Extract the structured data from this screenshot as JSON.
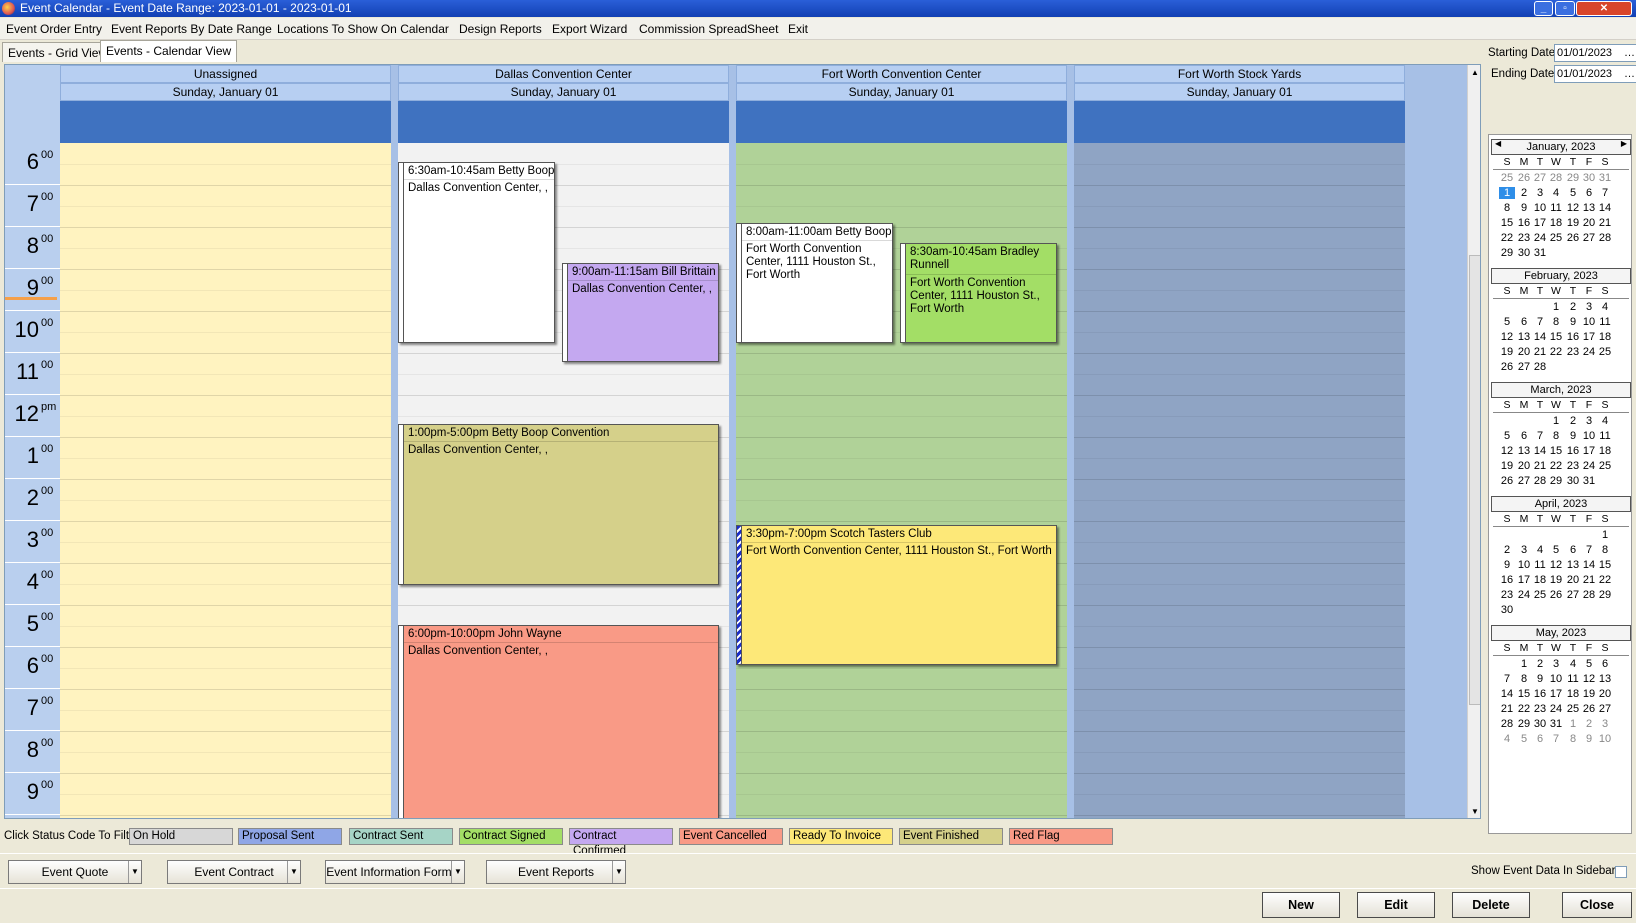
{
  "window": {
    "title": "Event Calendar - Event Date Range: 2023-01-01 - 2023-01-01"
  },
  "menu": [
    "Event Order Entry",
    "Event Reports By Date Range",
    "Locations To Show On Calendar",
    "Design Reports",
    "Export Wizard",
    "Commission SpreadSheet",
    "Exit"
  ],
  "tabs": [
    "Events - Grid View",
    "Events - Calendar View"
  ],
  "hours": [
    {
      "h": "6",
      "m": "00"
    },
    {
      "h": "7",
      "m": "00"
    },
    {
      "h": "8",
      "m": "00"
    },
    {
      "h": "9",
      "m": "00"
    },
    {
      "h": "10",
      "m": "00"
    },
    {
      "h": "11",
      "m": "00"
    },
    {
      "h": "12",
      "m": "pm"
    },
    {
      "h": "1",
      "m": "00"
    },
    {
      "h": "2",
      "m": "00"
    },
    {
      "h": "3",
      "m": "00"
    },
    {
      "h": "4",
      "m": "00"
    },
    {
      "h": "5",
      "m": "00"
    },
    {
      "h": "6",
      "m": "00"
    },
    {
      "h": "7",
      "m": "00"
    },
    {
      "h": "8",
      "m": "00"
    },
    {
      "h": "9",
      "m": "00"
    }
  ],
  "columns": [
    {
      "name": "Unassigned",
      "date": "Sunday, January 01",
      "bg": "#fff3c0"
    },
    {
      "name": "Dallas Convention Center",
      "date": "Sunday, January 01",
      "bg": "#f2f2f2"
    },
    {
      "name": "Fort Worth Convention Center",
      "date": "Sunday, January 01",
      "bg": "#b0d298"
    },
    {
      "name": "Fort Worth Stock Yards",
      "date": "Sunday, January 01",
      "bg": "#8fa4c4"
    }
  ],
  "events": [
    {
      "title": "6:30am-10:45am Betty Boop",
      "body": "Dallas Convention Center, ,",
      "color": "#ffffff"
    },
    {
      "title": "9:00am-11:15am Bill Brittain",
      "body": "Dallas Convention Center, ,",
      "color": "#c4a8f0"
    },
    {
      "title": "1:00pm-5:00pm Betty Boop Convention",
      "body": "Dallas Convention Center, ,",
      "color": "#d5d08a"
    },
    {
      "title": "6:00pm-10:00pm John Wayne",
      "body": "Dallas Convention Center, ,",
      "color": "#f99a86"
    },
    {
      "title": "8:00am-11:00am Betty Boop",
      "body": "Fort Worth Convention Center, 1111 Houston St., Fort Worth",
      "color": "#ffffff"
    },
    {
      "title": "8:30am-10:45am Bradley Runnell",
      "body": "Fort Worth Convention Center, 1111 Houston St., Fort Worth",
      "color": "#a3de66"
    },
    {
      "title": "3:30pm-7:00pm Scotch Tasters Club",
      "body": "Fort Worth Convention Center, 1111 Houston St., Fort Worth",
      "color": "#fde878"
    }
  ],
  "sidebar": {
    "starting_label": "Starting Date",
    "starting_value": "01/01/2023",
    "ending_label": "Ending Date",
    "ending_value": "01/01/2023",
    "dow": [
      "S",
      "M",
      "T",
      "W",
      "T",
      "F",
      "S"
    ],
    "months": [
      {
        "title": "January, 2023",
        "weeks": [
          [
            "25",
            "26",
            "27",
            "28",
            "29",
            "30",
            "31"
          ],
          [
            "1",
            "2",
            "3",
            "4",
            "5",
            "6",
            "7"
          ],
          [
            "8",
            "9",
            "10",
            "11",
            "12",
            "13",
            "14"
          ],
          [
            "15",
            "16",
            "17",
            "18",
            "19",
            "20",
            "21"
          ],
          [
            "22",
            "23",
            "24",
            "25",
            "26",
            "27",
            "28"
          ],
          [
            "29",
            "30",
            "31",
            "",
            "",
            "",
            ""
          ]
        ]
      },
      {
        "title": "February, 2023",
        "weeks": [
          [
            "",
            "",
            "",
            "1",
            "2",
            "3",
            "4"
          ],
          [
            "5",
            "6",
            "7",
            "8",
            "9",
            "10",
            "11"
          ],
          [
            "12",
            "13",
            "14",
            "15",
            "16",
            "17",
            "18"
          ],
          [
            "19",
            "20",
            "21",
            "22",
            "23",
            "24",
            "25"
          ],
          [
            "26",
            "27",
            "28",
            "",
            "",
            "",
            ""
          ]
        ]
      },
      {
        "title": "March, 2023",
        "weeks": [
          [
            "",
            "",
            "",
            "1",
            "2",
            "3",
            "4"
          ],
          [
            "5",
            "6",
            "7",
            "8",
            "9",
            "10",
            "11"
          ],
          [
            "12",
            "13",
            "14",
            "15",
            "16",
            "17",
            "18"
          ],
          [
            "19",
            "20",
            "21",
            "22",
            "23",
            "24",
            "25"
          ],
          [
            "26",
            "27",
            "28",
            "29",
            "30",
            "31",
            ""
          ]
        ]
      },
      {
        "title": "April, 2023",
        "weeks": [
          [
            "",
            "",
            "",
            "",
            "",
            "",
            "1"
          ],
          [
            "2",
            "3",
            "4",
            "5",
            "6",
            "7",
            "8"
          ],
          [
            "9",
            "10",
            "11",
            "12",
            "13",
            "14",
            "15"
          ],
          [
            "16",
            "17",
            "18",
            "19",
            "20",
            "21",
            "22"
          ],
          [
            "23",
            "24",
            "25",
            "26",
            "27",
            "28",
            "29"
          ],
          [
            "30",
            "",
            "",
            "",
            "",
            "",
            ""
          ]
        ]
      },
      {
        "title": "May, 2023",
        "weeks": [
          [
            "",
            "1",
            "2",
            "3",
            "4",
            "5",
            "6"
          ],
          [
            "7",
            "8",
            "9",
            "10",
            "11",
            "12",
            "13"
          ],
          [
            "14",
            "15",
            "16",
            "17",
            "18",
            "19",
            "20"
          ],
          [
            "21",
            "22",
            "23",
            "24",
            "25",
            "26",
            "27"
          ],
          [
            "28",
            "29",
            "30",
            "31",
            "1",
            "2",
            "3"
          ],
          [
            "4",
            "5",
            "6",
            "7",
            "8",
            "9",
            "10"
          ]
        ]
      }
    ]
  },
  "status": {
    "filter_label": "Click Status Code To Filter",
    "codes": [
      {
        "label": "On Hold",
        "color": "#d7d7d7"
      },
      {
        "label": "Proposal Sent",
        "color": "#8fa6e6"
      },
      {
        "label": "Contract Sent",
        "color": "#a6d4c6"
      },
      {
        "label": "Contract Signed",
        "color": "#a3de66"
      },
      {
        "label": "Contract Confirmed",
        "color": "#c4a8f0"
      },
      {
        "label": "Event Cancelled",
        "color": "#f99a86"
      },
      {
        "label": "Ready To Invoice",
        "color": "#fde878"
      },
      {
        "label": "Event Finished",
        "color": "#d5d08a"
      },
      {
        "label": "Red Flag",
        "color": "#f99a86"
      }
    ]
  },
  "actions": {
    "dropdowns": [
      "Event Quote",
      "Event Contract",
      "Event Information Form",
      "Event Reports"
    ],
    "show_sidebar_label": "Show Event Data In Sidebar",
    "new": "New",
    "edit": "Edit",
    "delete": "Delete",
    "close": "Close"
  }
}
